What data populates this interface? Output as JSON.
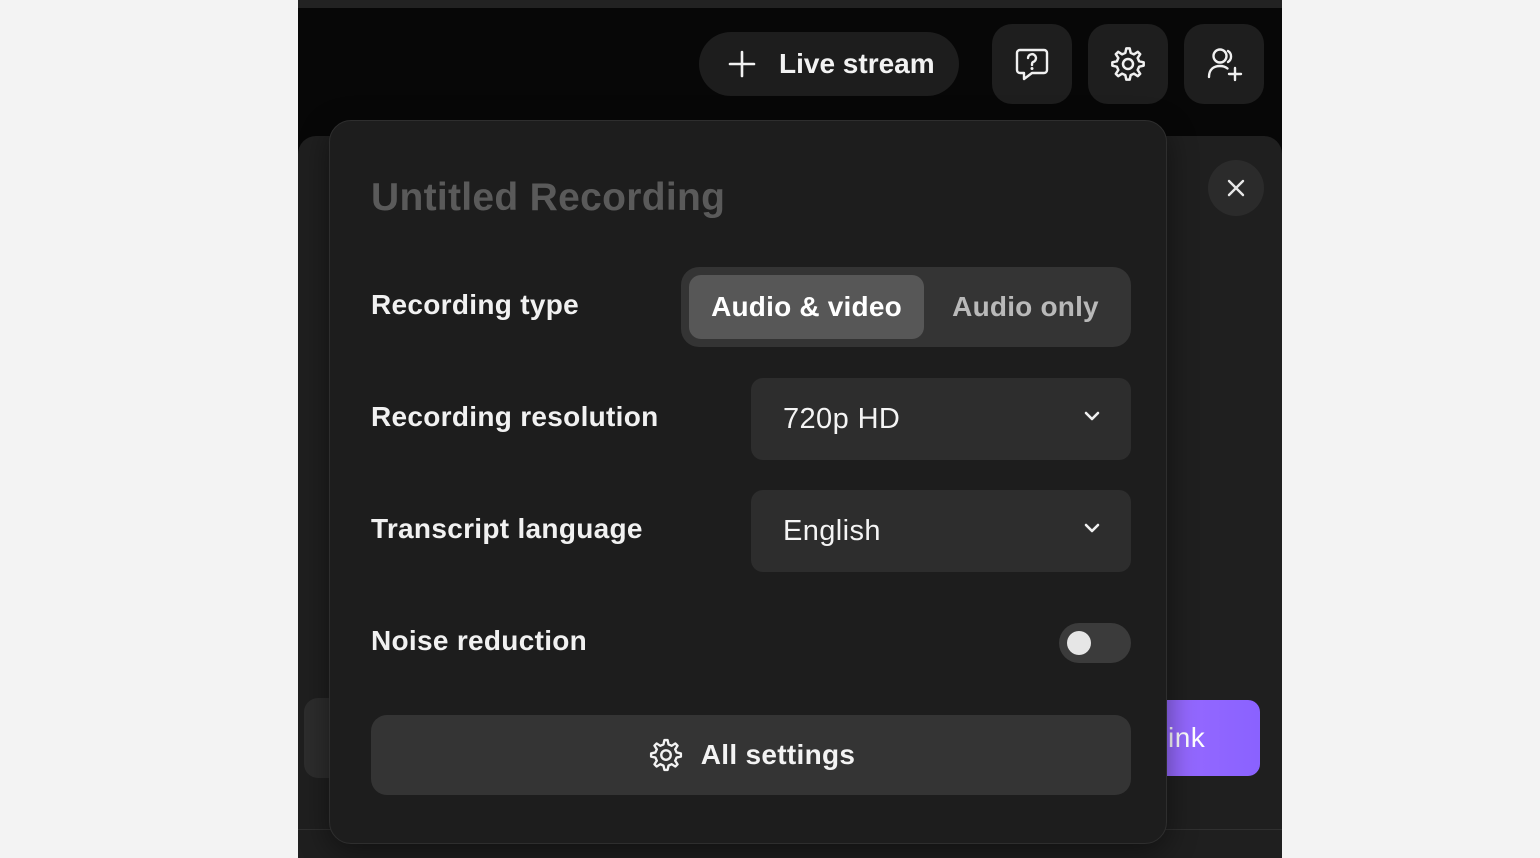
{
  "header": {
    "live_stream_label": "Live stream",
    "icons": [
      "plus-icon",
      "help-chat-icon",
      "gear-icon",
      "add-user-icon"
    ]
  },
  "background": {
    "link_button_text": "ink",
    "accent_color": "#8f66ff"
  },
  "panel": {
    "title": "Untitled Recording",
    "recording_type": {
      "label": "Recording type",
      "options": [
        "Audio & video",
        "Audio only"
      ],
      "selected": "Audio & video"
    },
    "recording_resolution": {
      "label": "Recording resolution",
      "value": "720p HD"
    },
    "transcript_language": {
      "label": "Transcript language",
      "value": "English"
    },
    "noise_reduction": {
      "label": "Noise reduction",
      "enabled": false
    },
    "all_settings_label": "All settings"
  }
}
